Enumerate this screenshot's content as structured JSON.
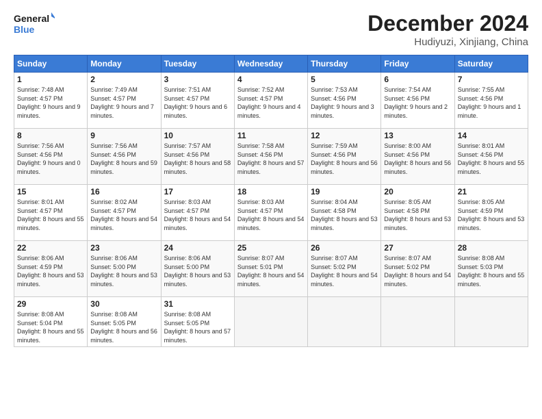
{
  "logo": {
    "text_general": "General",
    "text_blue": "Blue"
  },
  "title": "December 2024",
  "subtitle": "Hudiyuzi, Xinjiang, China",
  "days_of_week": [
    "Sunday",
    "Monday",
    "Tuesday",
    "Wednesday",
    "Thursday",
    "Friday",
    "Saturday"
  ],
  "weeks": [
    [
      {
        "day": "1",
        "sunrise": "7:48 AM",
        "sunset": "4:57 PM",
        "daylight": "9 hours and 9 minutes."
      },
      {
        "day": "2",
        "sunrise": "7:49 AM",
        "sunset": "4:57 PM",
        "daylight": "9 hours and 7 minutes."
      },
      {
        "day": "3",
        "sunrise": "7:51 AM",
        "sunset": "4:57 PM",
        "daylight": "9 hours and 6 minutes."
      },
      {
        "day": "4",
        "sunrise": "7:52 AM",
        "sunset": "4:57 PM",
        "daylight": "9 hours and 4 minutes."
      },
      {
        "day": "5",
        "sunrise": "7:53 AM",
        "sunset": "4:56 PM",
        "daylight": "9 hours and 3 minutes."
      },
      {
        "day": "6",
        "sunrise": "7:54 AM",
        "sunset": "4:56 PM",
        "daylight": "9 hours and 2 minutes."
      },
      {
        "day": "7",
        "sunrise": "7:55 AM",
        "sunset": "4:56 PM",
        "daylight": "9 hours and 1 minute."
      }
    ],
    [
      {
        "day": "8",
        "sunrise": "7:56 AM",
        "sunset": "4:56 PM",
        "daylight": "9 hours and 0 minutes."
      },
      {
        "day": "9",
        "sunrise": "7:56 AM",
        "sunset": "4:56 PM",
        "daylight": "8 hours and 59 minutes."
      },
      {
        "day": "10",
        "sunrise": "7:57 AM",
        "sunset": "4:56 PM",
        "daylight": "8 hours and 58 minutes."
      },
      {
        "day": "11",
        "sunrise": "7:58 AM",
        "sunset": "4:56 PM",
        "daylight": "8 hours and 57 minutes."
      },
      {
        "day": "12",
        "sunrise": "7:59 AM",
        "sunset": "4:56 PM",
        "daylight": "8 hours and 56 minutes."
      },
      {
        "day": "13",
        "sunrise": "8:00 AM",
        "sunset": "4:56 PM",
        "daylight": "8 hours and 56 minutes."
      },
      {
        "day": "14",
        "sunrise": "8:01 AM",
        "sunset": "4:56 PM",
        "daylight": "8 hours and 55 minutes."
      }
    ],
    [
      {
        "day": "15",
        "sunrise": "8:01 AM",
        "sunset": "4:57 PM",
        "daylight": "8 hours and 55 minutes."
      },
      {
        "day": "16",
        "sunrise": "8:02 AM",
        "sunset": "4:57 PM",
        "daylight": "8 hours and 54 minutes."
      },
      {
        "day": "17",
        "sunrise": "8:03 AM",
        "sunset": "4:57 PM",
        "daylight": "8 hours and 54 minutes."
      },
      {
        "day": "18",
        "sunrise": "8:03 AM",
        "sunset": "4:57 PM",
        "daylight": "8 hours and 54 minutes."
      },
      {
        "day": "19",
        "sunrise": "8:04 AM",
        "sunset": "4:58 PM",
        "daylight": "8 hours and 53 minutes."
      },
      {
        "day": "20",
        "sunrise": "8:05 AM",
        "sunset": "4:58 PM",
        "daylight": "8 hours and 53 minutes."
      },
      {
        "day": "21",
        "sunrise": "8:05 AM",
        "sunset": "4:59 PM",
        "daylight": "8 hours and 53 minutes."
      }
    ],
    [
      {
        "day": "22",
        "sunrise": "8:06 AM",
        "sunset": "4:59 PM",
        "daylight": "8 hours and 53 minutes."
      },
      {
        "day": "23",
        "sunrise": "8:06 AM",
        "sunset": "5:00 PM",
        "daylight": "8 hours and 53 minutes."
      },
      {
        "day": "24",
        "sunrise": "8:06 AM",
        "sunset": "5:00 PM",
        "daylight": "8 hours and 53 minutes."
      },
      {
        "day": "25",
        "sunrise": "8:07 AM",
        "sunset": "5:01 PM",
        "daylight": "8 hours and 54 minutes."
      },
      {
        "day": "26",
        "sunrise": "8:07 AM",
        "sunset": "5:02 PM",
        "daylight": "8 hours and 54 minutes."
      },
      {
        "day": "27",
        "sunrise": "8:07 AM",
        "sunset": "5:02 PM",
        "daylight": "8 hours and 54 minutes."
      },
      {
        "day": "28",
        "sunrise": "8:08 AM",
        "sunset": "5:03 PM",
        "daylight": "8 hours and 55 minutes."
      }
    ],
    [
      {
        "day": "29",
        "sunrise": "8:08 AM",
        "sunset": "5:04 PM",
        "daylight": "8 hours and 55 minutes."
      },
      {
        "day": "30",
        "sunrise": "8:08 AM",
        "sunset": "5:05 PM",
        "daylight": "8 hours and 56 minutes."
      },
      {
        "day": "31",
        "sunrise": "8:08 AM",
        "sunset": "5:05 PM",
        "daylight": "8 hours and 57 minutes."
      },
      null,
      null,
      null,
      null
    ]
  ]
}
